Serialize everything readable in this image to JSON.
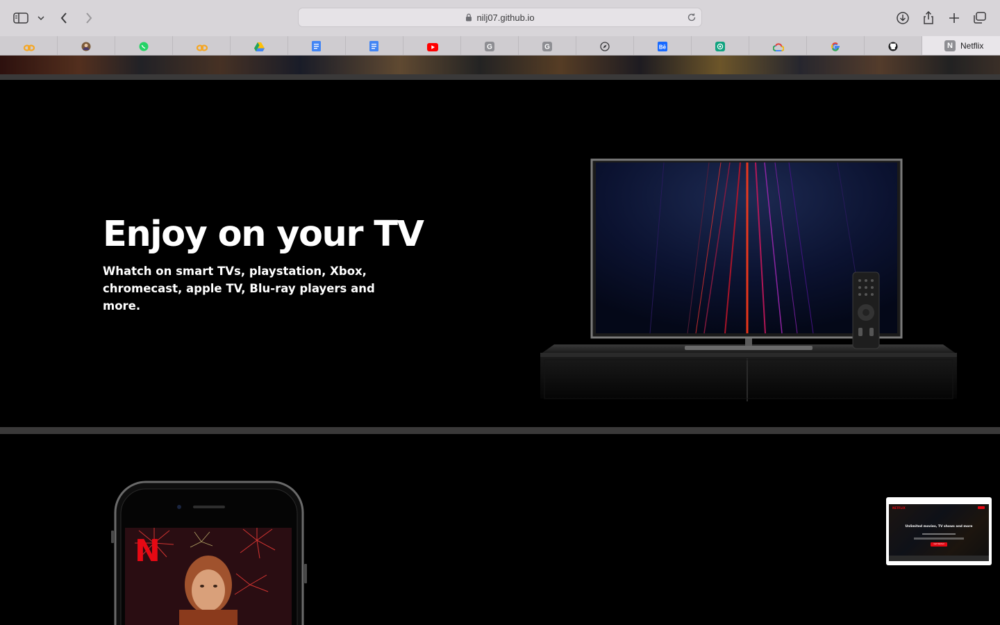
{
  "browser": {
    "url": "nilj07.github.io",
    "favorites": [
      {
        "icon": "loop-orange-icon",
        "color": "#f5a623"
      },
      {
        "icon": "avatar-icon",
        "color": "#7a5a3a"
      },
      {
        "icon": "whatsapp-icon",
        "color": "#25d366"
      },
      {
        "icon": "loop-orange-icon",
        "color": "#f5a623"
      },
      {
        "icon": "google-drive-icon",
        "color": "#1fa463"
      },
      {
        "icon": "google-docs-icon",
        "color": "#4285f4"
      },
      {
        "icon": "google-docs-icon",
        "color": "#4285f4"
      },
      {
        "icon": "youtube-icon",
        "color": "#ff0000"
      },
      {
        "icon": "letter-g-icon",
        "color": "#8e8e93"
      },
      {
        "icon": "letter-g-icon",
        "color": "#8e8e93"
      },
      {
        "icon": "compass-icon",
        "color": "#3a3a3c"
      },
      {
        "icon": "behance-icon",
        "color": "#1769ff"
      },
      {
        "icon": "chatgpt-icon",
        "color": "#10a37f"
      },
      {
        "icon": "google-cloud-icon",
        "color": "#ea4335"
      },
      {
        "icon": "google-icon",
        "color": "#4285f4"
      },
      {
        "icon": "github-icon",
        "color": "#1d1d1f"
      }
    ],
    "active_tab": {
      "icon": "netflix-n-icon",
      "letter": "N",
      "title": "Netflix"
    }
  },
  "section_tv": {
    "title": "Enjoy on your TV",
    "subtitle": "Whatch on smart TVs, playstation, Xbox, chromecast, apple TV, Blu-ray players and more."
  },
  "phone": {
    "logo_letter": "N"
  },
  "thumbnail": {
    "logo": "NETFLIX",
    "headline": "Unlimited movies, TV shows and more",
    "cta": "Get Started"
  },
  "colors": {
    "netflix_red": "#e50914",
    "background": "#000000",
    "divider": "#3a3939"
  }
}
